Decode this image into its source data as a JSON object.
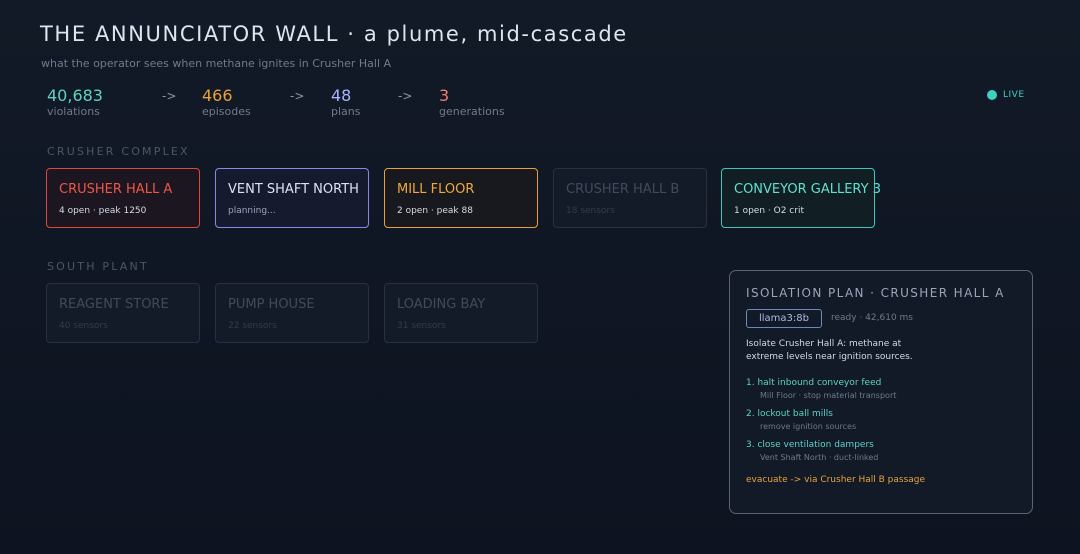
{
  "header": {
    "title": "THE ANNUNCIATOR WALL · a plume, mid-cascade",
    "subtitle": "what the operator sees when methane ignites in Crusher Hall A"
  },
  "pipeline": {
    "stats": [
      {
        "value": "40,683",
        "label": "violations",
        "color": "#5ed3c4"
      },
      {
        "value": "466",
        "label": "episodes",
        "color": "#e8a23c"
      },
      {
        "value": "48",
        "label": "plans",
        "color": "#a9b3ff"
      },
      {
        "value": "3",
        "label": "generations",
        "color": "#ef7b6e"
      }
    ],
    "arrow": "->"
  },
  "live": {
    "label": "LIVE",
    "color": "#3fd1c0"
  },
  "sections": {
    "crusher_complex": "CRUSHER COMPLEX",
    "south_plant": "SOUTH PLANT"
  },
  "crusher_complex": [
    {
      "name": "CRUSHER HALL A",
      "info": "4 open · peak 1250",
      "state": "alarm",
      "border": "#e0483e",
      "name_color": "#f0564a",
      "info_color": "#d6dbe3",
      "bg": "#1b1620"
    },
    {
      "name": "VENT SHAFT NORTH",
      "info": "planning...",
      "state": "planning",
      "border": "#8b86e8",
      "name_color": "#dde2f2",
      "info_color": "#9aa4bf",
      "bg": "#161a2e"
    },
    {
      "name": "MILL FLOOR",
      "info": "2 open · peak 88",
      "state": "warning",
      "border": "#e8a03a",
      "name_color": "#f0a93e",
      "info_color": "#d6dbe3",
      "bg": "#17191f"
    },
    {
      "name": "CRUSHER HALL B",
      "info": "18 sensors",
      "state": "idle"
    },
    {
      "name": "CONVEYOR GALLERY 3",
      "info": "1 open · O2 crit",
      "state": "active",
      "border": "#3fc8b8",
      "name_color": "#62e0d1",
      "info_color": "#d6dbe3",
      "bg": "#111e24"
    }
  ],
  "south_plant": [
    {
      "name": "REAGENT STORE",
      "info": "40 sensors",
      "state": "idle"
    },
    {
      "name": "PUMP HOUSE",
      "info": "22 sensors",
      "state": "idle"
    },
    {
      "name": "LOADING BAY",
      "info": "31 sensors",
      "state": "idle"
    }
  ],
  "plan": {
    "title": "ISOLATION PLAN · CRUSHER HALL A",
    "model": "llama3:8b",
    "status": "ready · 42,610 ms",
    "summary": "Isolate Crusher Hall A: methane at extreme levels near ignition sources.",
    "steps": [
      {
        "action": "1. halt inbound conveyor feed",
        "detail": "Mill Floor · stop material transport"
      },
      {
        "action": "2. lockout ball mills",
        "detail": "remove ignition sources"
      },
      {
        "action": "3. close ventilation dampers",
        "detail": "Vent Shaft North · duct-linked"
      }
    ],
    "evacuate": "evacuate -> via Crusher Hall B passage",
    "evacuate_color": "#e8a23c"
  }
}
